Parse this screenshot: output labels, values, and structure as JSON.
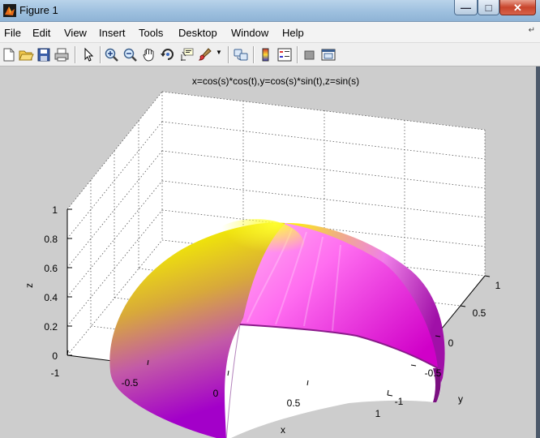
{
  "window": {
    "title": "Figure 1",
    "minimize": "—",
    "maximize": "□",
    "close": "✕"
  },
  "menu": {
    "items": [
      "File",
      "Edit",
      "View",
      "Insert",
      "Tools",
      "Desktop",
      "Window",
      "Help"
    ],
    "overflow_icon": "arrow-icon"
  },
  "toolbar": {
    "icons": [
      "new-figure-icon",
      "open-file-icon",
      "save-icon",
      "print-icon",
      "edit-plot-arrow-icon",
      "zoom-in-icon",
      "zoom-out-icon",
      "pan-hand-icon",
      "rotate-3d-icon",
      "data-cursor-icon",
      "brush-icon",
      "link-plot-icon",
      "colorbar-icon",
      "legend-icon",
      "hide-plot-tools-icon",
      "show-plot-tools-icon"
    ]
  },
  "plot": {
    "title": "x=cos(s)*cos(t),y=cos(s)*sin(t),z=sin(s)",
    "xlabel": "x",
    "ylabel": "y",
    "zlabel": "z",
    "xticks": [
      "-1",
      "-0.5",
      "0",
      "0.5",
      "1"
    ],
    "yticks": [
      "-1",
      "-0.5",
      "0",
      "0.5",
      "1"
    ],
    "zticks": [
      "0",
      "0.2",
      "0.4",
      "0.6",
      "0.8",
      "1"
    ]
  },
  "chart_data": {
    "type": "surface",
    "title": "x=cos(s)*cos(t),y=cos(s)*sin(t),z=sin(s)",
    "xlabel": "x",
    "ylabel": "y",
    "zlabel": "z",
    "xlim": [
      -1,
      1
    ],
    "ylim": [
      -1,
      1
    ],
    "zlim": [
      0,
      1
    ],
    "grid": true,
    "surface": "upper unit hemisphere with one quarter (x>0, y<0) removed",
    "colormap": [
      "#a800c0",
      "#ff40ff",
      "#ffff00"
    ]
  }
}
